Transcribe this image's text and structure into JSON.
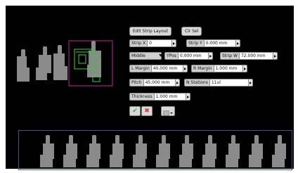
{
  "buttons": {
    "edit_strip_layout": "Edit Strip Layout",
    "clr_sel": "Clr Sel"
  },
  "fields": {
    "strip_x": {
      "label": "Strip X",
      "value": "0"
    },
    "strip_y": {
      "label": "Strip Y",
      "value": "0.000 mm"
    },
    "align": {
      "value": "Middle"
    },
    "ypos": {
      "label": "YPos",
      "value": "0.000 mm"
    },
    "strip_w": {
      "label": "Strip W",
      "value": "72.000 mm"
    },
    "l_margin": {
      "label": "L Margin",
      "value": "40.000 mm"
    },
    "r_margin": {
      "label": "R Margin",
      "value": "1.000 mm"
    },
    "pitch": {
      "label": "Pitch",
      "value": "45.000 mm"
    },
    "n_stations": {
      "label": "N Stations",
      "value": "11ul"
    },
    "thickness": {
      "label": "Thickness",
      "value": "1.000 mm"
    }
  },
  "actions": {
    "accept_icon": "check-icon",
    "cancel_icon": "x-icon",
    "menu_icon": "list-menu-icon"
  },
  "colors": {
    "background": "#000000",
    "part": "#8a8a8a",
    "selection_frame": "#c81f9c",
    "pcb_green": "#2fd33a",
    "bottom_border": "#4b4f88",
    "ok": "#2aa84a",
    "cancel": "#d23a3a"
  }
}
